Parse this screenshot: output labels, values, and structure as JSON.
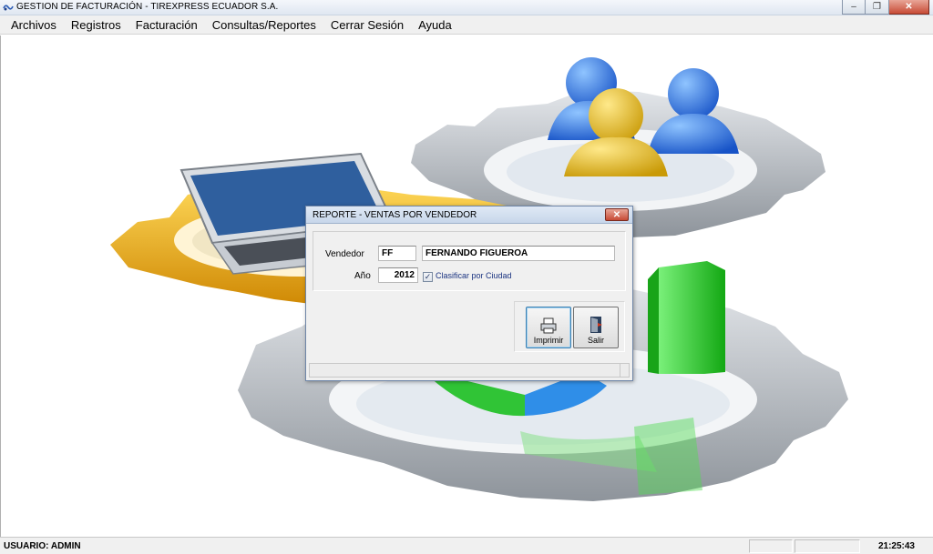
{
  "window": {
    "title": "GESTION DE FACTURACIÓN - TIREXPRESS ECUADOR S.A.",
    "minimize_glyph": "–",
    "restore_glyph": "❐",
    "close_glyph": "✕"
  },
  "menu": [
    {
      "label": "Archivos"
    },
    {
      "label": "Registros"
    },
    {
      "label": "Facturación"
    },
    {
      "label": "Consultas/Reportes"
    },
    {
      "label": "Cerrar Sesión"
    },
    {
      "label": "Ayuda"
    }
  ],
  "dialog": {
    "title": "REPORTE -  VENTAS POR VENDEDOR",
    "close_glyph": "✕",
    "vendedor_label": "Vendedor",
    "vendedor_code": "FF",
    "vendedor_name": "FERNANDO FIGUEROA",
    "anio_label": "Año",
    "anio_value": "2012",
    "clasificar_checked": true,
    "check_glyph": "✓",
    "clasificar_label": "Clasificar por Ciudad",
    "print_button": "Imprimir",
    "exit_button": "Salir"
  },
  "statusbar": {
    "user": "USUARIO: ADMIN",
    "time": "21:25:43"
  },
  "icons": {
    "app": "app-icon",
    "printer": "printer-icon",
    "exit": "door-exit-icon"
  },
  "colors": {
    "accent_gold": "#f2b817",
    "accent_blue": "#2f7fe0",
    "accent_green": "#2fcf2f",
    "gear_gray": "#b7bcc2"
  }
}
